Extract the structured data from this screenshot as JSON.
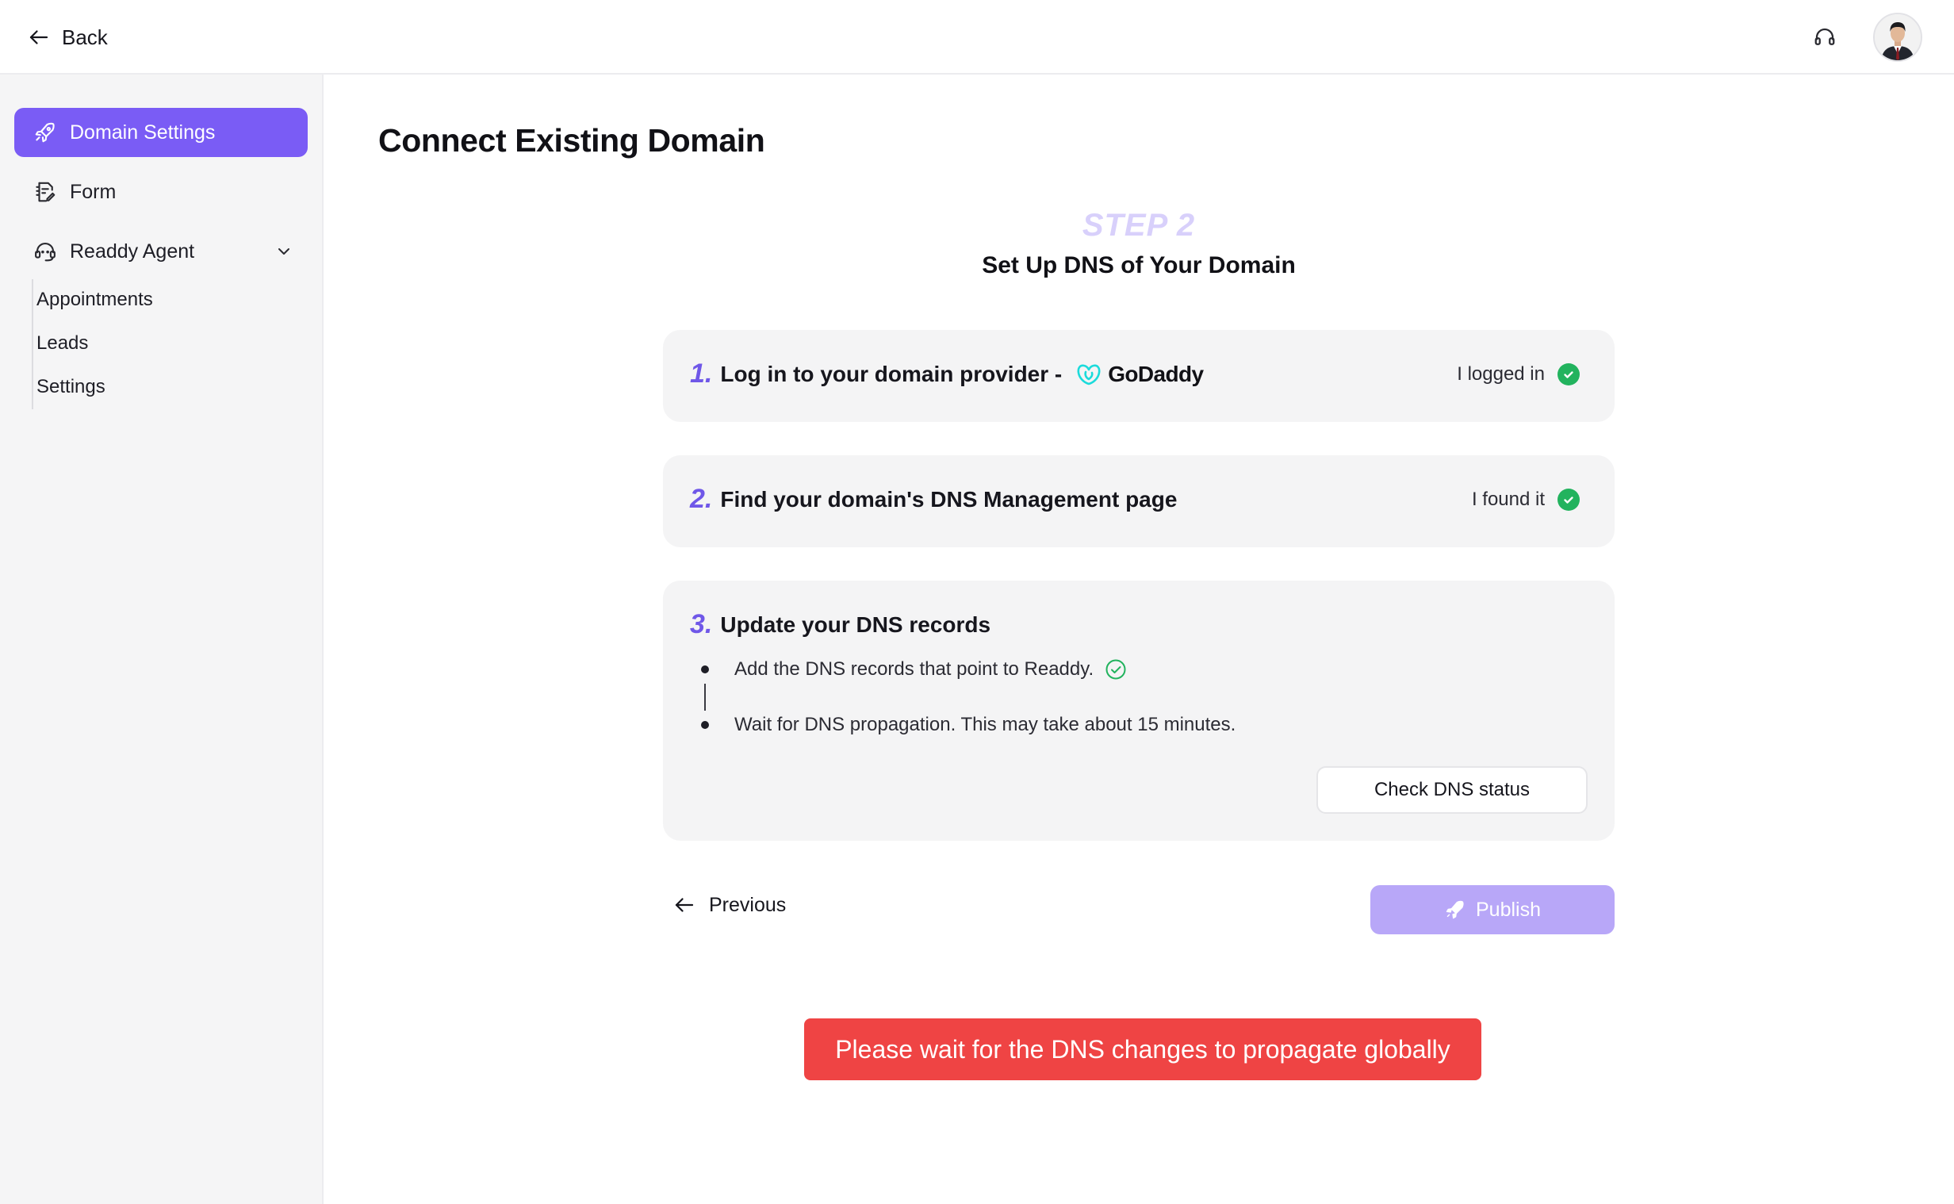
{
  "topbar": {
    "back_label": "Back",
    "support_icon": "headset-icon",
    "avatar_icon": "user-avatar"
  },
  "sidebar": {
    "items": [
      {
        "label": "Domain Settings",
        "icon": "rocket-icon",
        "active": true
      },
      {
        "label": "Form",
        "icon": "form-edit-icon",
        "active": false
      },
      {
        "label": "Readdy Agent",
        "icon": "agent-headset-icon",
        "active": false,
        "expanded": true
      }
    ],
    "subitems": [
      {
        "label": "Appointments"
      },
      {
        "label": "Leads"
      },
      {
        "label": "Settings"
      }
    ]
  },
  "main": {
    "title": "Connect Existing Domain",
    "step_tag": "STEP 2",
    "step_title": "Set Up DNS of Your Domain",
    "steps": [
      {
        "number": "1.",
        "text": "Log in to your domain provider -",
        "provider": "GoDaddy",
        "confirm_label": "I logged in",
        "confirmed": true
      },
      {
        "number": "2.",
        "text": "Find your domain's DNS Management page",
        "confirm_label": "I found it",
        "confirmed": true
      },
      {
        "number": "3.",
        "text": "Update your DNS records",
        "bullets": [
          {
            "text": "Add the DNS records that point to Readdy.",
            "done": true
          },
          {
            "text": "Wait for DNS propagation. This may take about 15 minutes.",
            "done": false
          }
        ],
        "check_button": "Check DNS status"
      }
    ],
    "previous_label": "Previous",
    "publish_label": "Publish",
    "toast": "Please wait for the DNS changes to propagate globally"
  },
  "colors": {
    "accent": "#7a5cf5",
    "accent_disabled": "#b8a7f8",
    "success": "#22b35e",
    "error": "#ef4444",
    "godaddy": "#1bdbdb"
  }
}
